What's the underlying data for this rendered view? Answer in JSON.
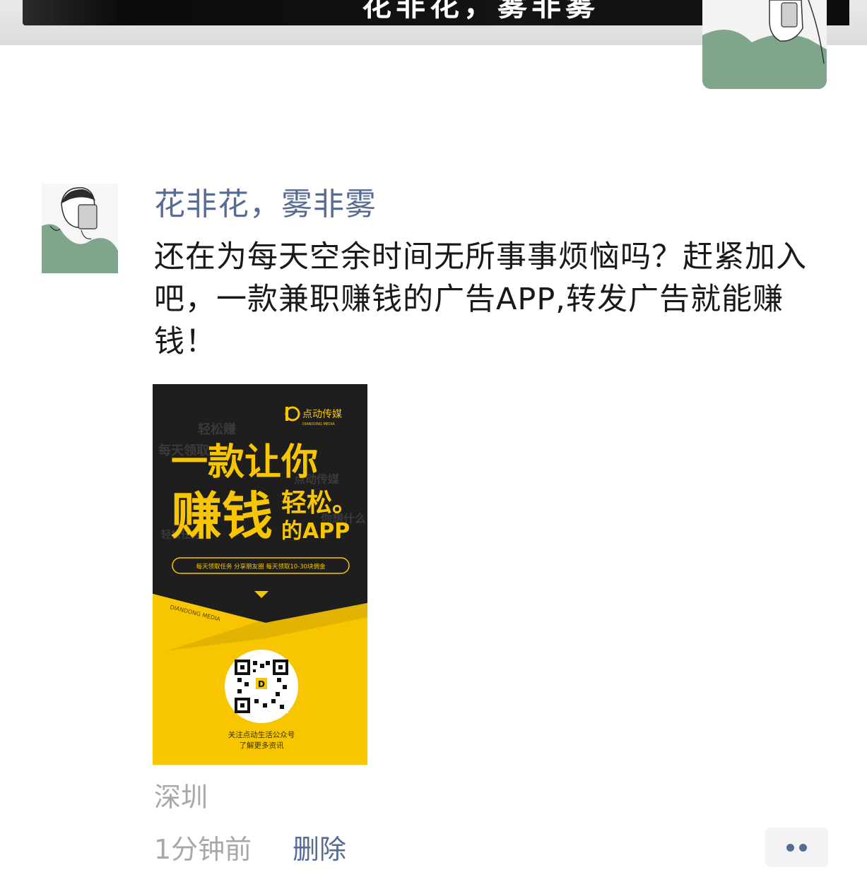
{
  "cover": {
    "title": "花非花，雾非雾"
  },
  "post": {
    "username": "花非花，雾非雾",
    "text": "还在为每天空余时间无所事事烦恼吗？赶紧加入吧，一款兼职赚钱的广告APP,转发广告就能赚钱！",
    "location": "深圳",
    "time": "1分钟前",
    "delete_label": "删除"
  },
  "poster": {
    "brand": "点动传媒",
    "brand_en": "DIANDONG MEDIA",
    "line1": "一款让你",
    "big": "赚钱",
    "small1": "轻松。",
    "small2": "的APP",
    "bg_words": [
      "轻松赚",
      "每天领取",
      "点动传媒",
      "你想什么",
      "轻松任务"
    ],
    "pill": "每天领取任务 分享朋友圈 每天领取10-30块佣金",
    "diag_text": "DIANDONG MEDIA",
    "follow1": "关注点动生活公众号",
    "follow2": "了解更多资讯",
    "colors": {
      "dark": "#1e1e1e",
      "yellow": "#f7c600"
    }
  },
  "colors": {
    "link": "#576b95",
    "meta": "#a8a8a8",
    "text": "#191919"
  }
}
